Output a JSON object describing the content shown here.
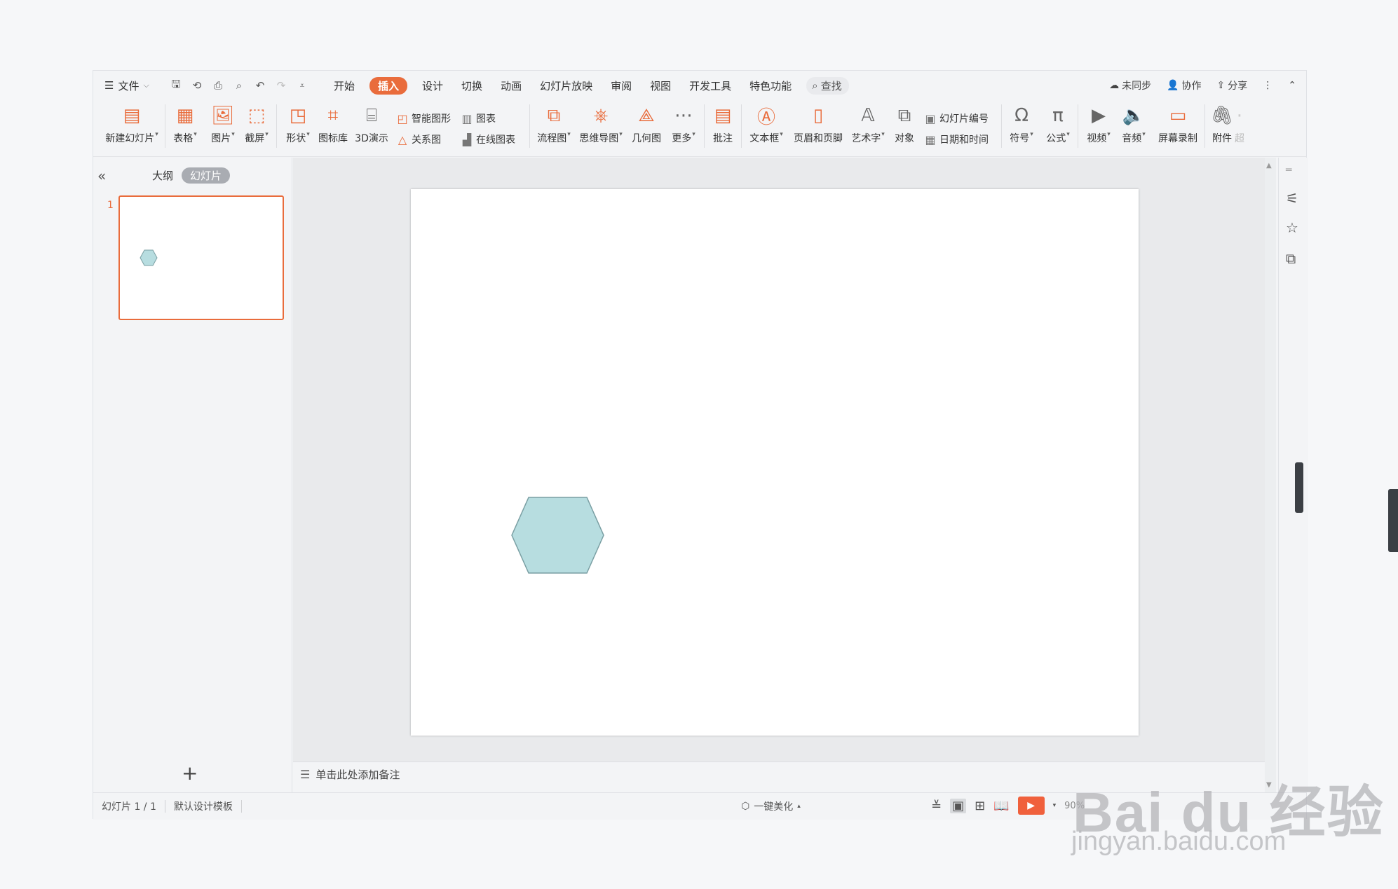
{
  "menubar": {
    "file_label": "文件",
    "tabs": [
      "开始",
      "插入",
      "设计",
      "切换",
      "动画",
      "幻灯片放映",
      "审阅",
      "视图",
      "开发工具",
      "特色功能"
    ],
    "active_tab": "插入",
    "search_label": "查找",
    "sync_label": "未同步",
    "collab_label": "协作",
    "share_label": "分享"
  },
  "ribbon": {
    "new_slide": "新建幻灯片",
    "table": "表格",
    "picture": "图片",
    "screenshot": "截屏",
    "shape": "形状",
    "icon_lib": "图标库",
    "demo3d": "3D演示",
    "smart_art": "智能图形",
    "relation": "关系图",
    "chart": "图表",
    "online_chart": "在线图表",
    "flowchart": "流程图",
    "mindmap": "思维导图",
    "geometry": "几何图",
    "more": "更多",
    "comment": "批注",
    "textbox": "文本框",
    "header_footer": "页眉和页脚",
    "wordart": "艺术字",
    "object": "对象",
    "slide_number": "幻灯片编号",
    "datetime": "日期和时间",
    "symbol": "符号",
    "formula": "公式",
    "video": "视频",
    "audio": "音频",
    "screen_record": "屏幕录制",
    "attachment": "附件",
    "overflow": "超"
  },
  "left_panel": {
    "outline_tab": "大纲",
    "slides_tab": "幻灯片",
    "slide_number": "1"
  },
  "slide": {
    "shape_name": "hexagon",
    "fill_color": "#b7dde0",
    "stroke_color": "#7a9fa3"
  },
  "notes": {
    "placeholder": "单击此处添加备注"
  },
  "statusbar": {
    "slide_count": "幻灯片 1 / 1",
    "template": "默认设计模板",
    "beautify": "一键美化",
    "zoom": "90%"
  },
  "watermark": {
    "logo": "Bai du 经验",
    "url": "jingyan.baidu.com"
  },
  "colors": {
    "accent": "#e96c3c",
    "play": "#f0603c"
  }
}
